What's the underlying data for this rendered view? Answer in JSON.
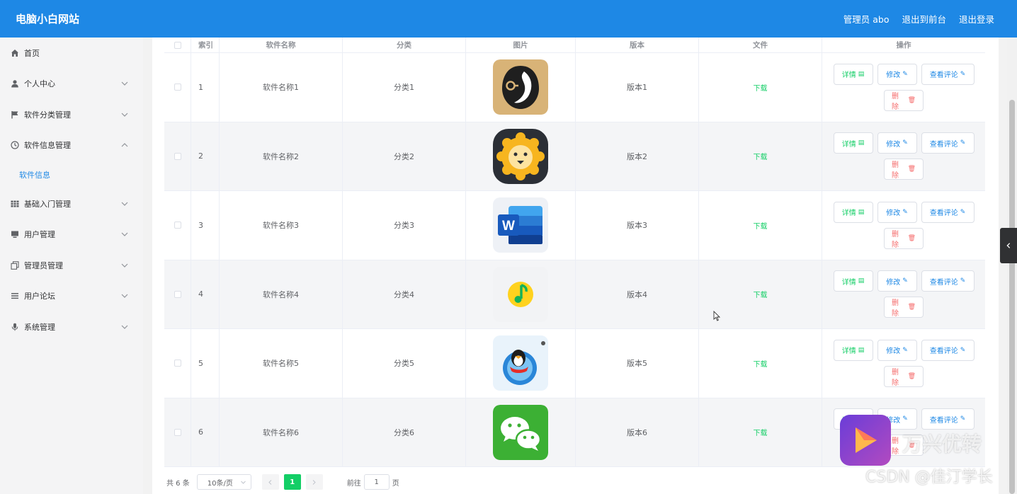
{
  "header": {
    "site_title": "电脑小白网站",
    "admin_label": "管理员 abo",
    "front_label": "退出到前台",
    "logout_label": "退出登录"
  },
  "sidebar": {
    "items": [
      {
        "label": "首页",
        "icon": "home-icon"
      },
      {
        "label": "个人中心",
        "icon": "user-icon"
      },
      {
        "label": "软件分类管理",
        "icon": "flag-icon"
      },
      {
        "label": "软件信息管理",
        "icon": "clock-icon"
      },
      {
        "label": "基础入门管理",
        "icon": "grid-icon"
      },
      {
        "label": "用户管理",
        "icon": "monitor-icon"
      },
      {
        "label": "管理员管理",
        "icon": "copy-icon"
      },
      {
        "label": "用户论坛",
        "icon": "list-icon"
      },
      {
        "label": "系统管理",
        "icon": "microphone-icon"
      }
    ],
    "submenu_active": "软件信息"
  },
  "table": {
    "columns": [
      "索引",
      "软件名称",
      "分类",
      "图片",
      "版本",
      "文件",
      "操作"
    ],
    "rows": [
      {
        "index": "1",
        "name": "软件名称1",
        "category": "分类1",
        "image": "penguin-app-icon",
        "version": "版本1",
        "file": "下载"
      },
      {
        "index": "2",
        "name": "软件名称2",
        "category": "分类2",
        "image": "lion-app-icon",
        "version": "版本2",
        "file": "下载"
      },
      {
        "index": "3",
        "name": "软件名称3",
        "category": "分类3",
        "image": "word-app-icon",
        "version": "版本3",
        "file": "下载"
      },
      {
        "index": "4",
        "name": "软件名称4",
        "category": "分类4",
        "image": "qq-music-app-icon",
        "version": "版本4",
        "file": "下载"
      },
      {
        "index": "5",
        "name": "软件名称5",
        "category": "分类5",
        "image": "qq-penguin-app-icon",
        "version": "版本5",
        "file": "下载"
      },
      {
        "index": "6",
        "name": "软件名称6",
        "category": "分类6",
        "image": "wechat-app-icon",
        "version": "版本6",
        "file": "下载"
      }
    ],
    "actions": {
      "detail": "详情",
      "edit": "修改",
      "review": "查看评论",
      "delete": "删除"
    }
  },
  "pagination": {
    "total": "共 6 条",
    "page_size": "10条/页",
    "current_page": "1",
    "goto_label": "前往",
    "goto_value": "1",
    "page_suffix": "页"
  },
  "watermark": {
    "brand": "万兴优转",
    "credit": "CSDN @佳汀学长"
  },
  "colors": {
    "header": "#1e88e5",
    "accent_green": "#13ce66",
    "danger": "#f56c6c"
  }
}
